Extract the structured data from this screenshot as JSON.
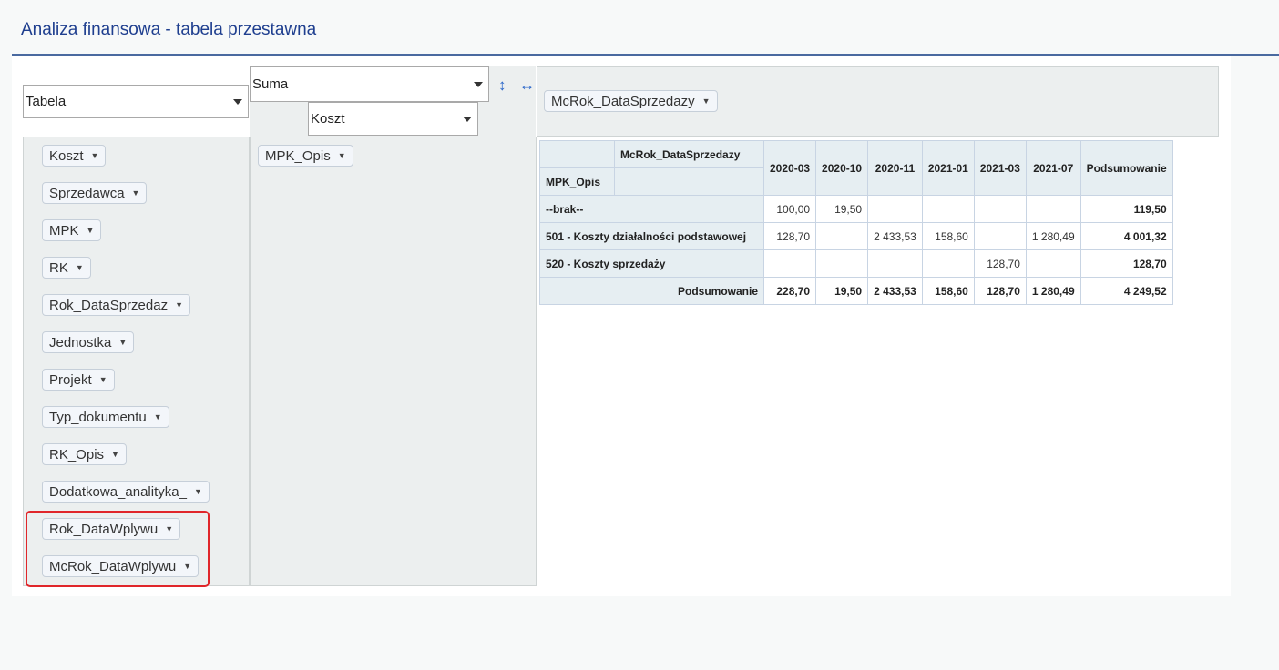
{
  "page": {
    "title": "Analiza finansowa - tabela przestawna"
  },
  "controls": {
    "renderer": "Tabela",
    "aggregator": "Suma",
    "aggregator_field": "Koszt"
  },
  "column_fields": [
    "McRok_DataSprzedazy"
  ],
  "row_fields": [
    "MPK_Opis"
  ],
  "unused_fields": [
    "Koszt",
    "Sprzedawca",
    "MPK",
    "RK",
    "Rok_DataSprzedaz",
    "Jednostka",
    "Projekt",
    "Typ_dokumentu",
    "RK_Opis",
    "Dodatkowa_analityka_",
    "Rok_DataWplywu",
    "McRok_DataWplywu"
  ],
  "table": {
    "col_attr_label": "McRok_DataSprzedazy",
    "row_attr_label": "MPK_Opis",
    "columns": [
      "2020-03",
      "2020-10",
      "2020-11",
      "2021-01",
      "2021-03",
      "2021-07"
    ],
    "total_label": "Podsumowanie",
    "rows": [
      {
        "label": "--brak--",
        "cells": [
          "100,00",
          "19,50",
          "",
          "",
          "",
          ""
        ],
        "total": "119,50"
      },
      {
        "label": "501 - Koszty działalności podstawowej",
        "cells": [
          "128,70",
          "",
          "2 433,53",
          "158,60",
          "",
          "1 280,49"
        ],
        "total": "4 001,32"
      },
      {
        "label": "520 - Koszty sprzedaży",
        "cells": [
          "",
          "",
          "",
          "",
          "128,70",
          ""
        ],
        "total": "128,70"
      }
    ],
    "totals_row": {
      "label": "Podsumowanie",
      "cells": [
        "228,70",
        "19,50",
        "2 433,53",
        "158,60",
        "128,70",
        "1 280,49"
      ],
      "total": "4 249,52"
    }
  },
  "colors": {
    "title": "#1f3f8f",
    "highlight": "#e0262a",
    "accent": "#2a66c9"
  },
  "icons": {
    "row_order": "vertical-arrows-icon",
    "col_order": "horizontal-arrows-icon",
    "dropdown": "triangle-down-icon"
  }
}
